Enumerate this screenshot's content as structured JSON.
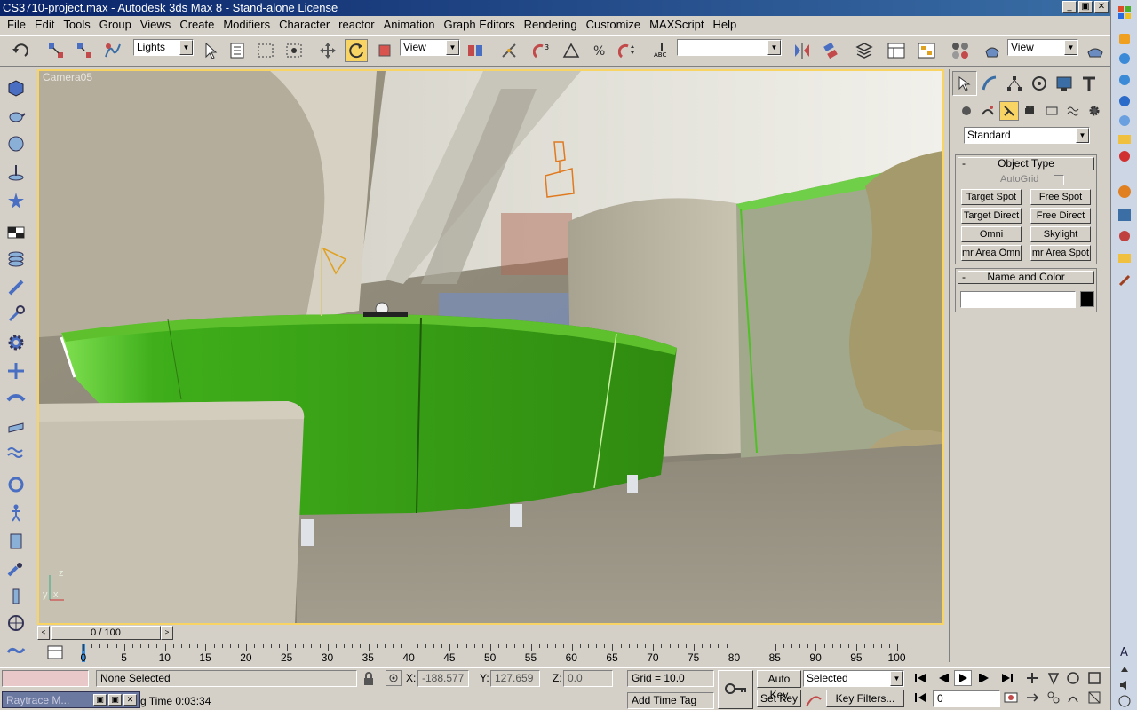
{
  "window": {
    "title": "CS3710-project.max - Autodesk 3ds Max 8  - Stand-alone License",
    "min_glyph": "_",
    "max_glyph": "▣",
    "close_glyph": "✕"
  },
  "menu": [
    "File",
    "Edit",
    "Tools",
    "Group",
    "Views",
    "Create",
    "Modifiers",
    "Character",
    "reactor",
    "Animation",
    "Graph Editors",
    "Rendering",
    "Customize",
    "MAXScript",
    "Help"
  ],
  "toolbar": {
    "selection_filter": "Lights",
    "ref_coord": "View",
    "named_selection": "",
    "render_type": "View",
    "dropdown_arrow": "▼"
  },
  "viewport": {
    "label": "Camera05",
    "axis_z": "z",
    "axis_y": "y",
    "axis_x": "x"
  },
  "command_panel": {
    "category": "Standard",
    "object_type_title": "Object Type",
    "autogrid_label": "AutoGrid",
    "autogrid_checked": false,
    "buttons": [
      "Target Spot",
      "Free Spot",
      "Target Direct",
      "Free Direct",
      "Omni",
      "Skylight",
      "mr Area Omni",
      "mr Area Spot"
    ],
    "name_color_title": "Name and Color",
    "name_value": "",
    "object_color": "#000000",
    "rollout_toggle": "-"
  },
  "time": {
    "slider_label": "0 / 100",
    "prev_arrow": "<",
    "next_arrow": ">",
    "ticks": [
      "0",
      "5",
      "10",
      "15",
      "20",
      "25",
      "30",
      "35",
      "40",
      "45",
      "50",
      "55",
      "60",
      "65",
      "70",
      "75",
      "80",
      "85",
      "90",
      "95",
      "100"
    ]
  },
  "status": {
    "selection": "None Selected",
    "x_label": "X:",
    "x_value": "-188.577",
    "y_label": "Y:",
    "y_value": "127.659",
    "z_label": "Z:",
    "z_value": "0.0",
    "grid": "Grid = 10.0",
    "render_time": "g Time  0:03:34",
    "add_time_tag": "Add Time Tag",
    "auto_key": "Auto Key",
    "set_key": "Set Key",
    "key_mode": "Selected",
    "key_filters": "Key Filters...",
    "frame": "0",
    "taskbar_item": "Raytrace M..."
  },
  "colors": {
    "accent": "#f7d463",
    "titlebar": "#0a246a",
    "green_object": "#3a9a12"
  }
}
